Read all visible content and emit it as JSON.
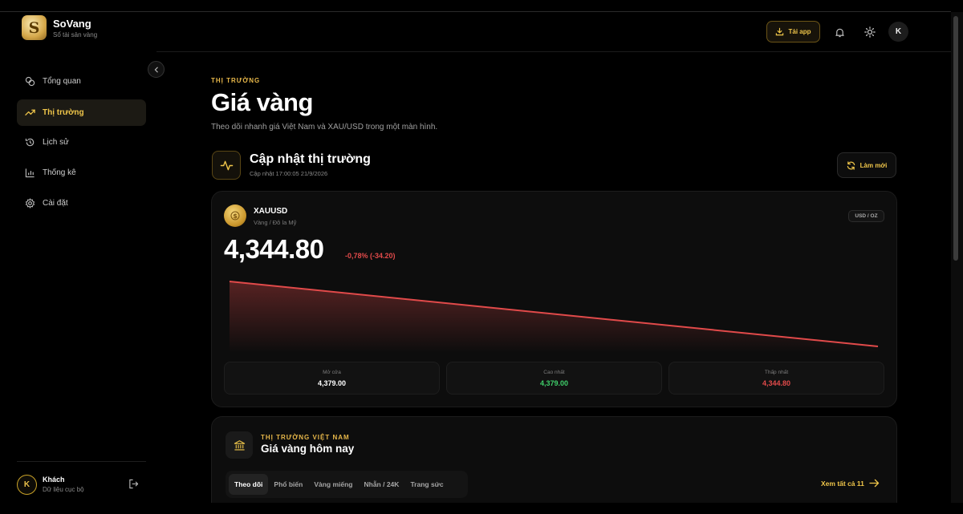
{
  "brand": {
    "name": "SoVang",
    "subtitle": "Sổ tài sản vàng",
    "logo_letter": "S"
  },
  "sidebar": {
    "items": [
      {
        "label": "Tổng quan",
        "icon": "coins-icon",
        "active": false
      },
      {
        "label": "Thị trường",
        "icon": "trending-up-icon",
        "active": true
      },
      {
        "label": "Lịch sử",
        "icon": "history-icon",
        "active": false
      },
      {
        "label": "Thống kê",
        "icon": "bar-chart-icon",
        "active": false
      },
      {
        "label": "Cài đặt",
        "icon": "gear-icon",
        "active": false
      }
    ],
    "user": {
      "initial": "K",
      "name": "Khách",
      "subtitle": "Dữ liệu cục bộ"
    }
  },
  "topbar": {
    "app_button": "Tải app",
    "avatar_initial": "K"
  },
  "header": {
    "eyebrow": "THỊ TRƯỜNG",
    "title": "Giá vàng",
    "subtitle": "Theo dõi nhanh giá Việt Nam và XAU/USD trong một màn hình."
  },
  "update": {
    "title": "Cập nhật thị trường",
    "time": "Cập nhật 17:00:05 21/9/2026",
    "refresh_label": "Làm mới"
  },
  "market": {
    "symbol": "XAUUSD",
    "symbol_sub": "Vàng / Đô la Mỹ",
    "unit": "USD / OZ",
    "price": "4,344.80",
    "change": "-0,78% (-34.20)",
    "trend_color": "#e14a4a",
    "stats": [
      {
        "label": "Mở cửa",
        "value": "4,379.00",
        "color": "#ffffff"
      },
      {
        "label": "Cao nhất",
        "value": "4,379.00",
        "color": "#3fcf6a"
      },
      {
        "label": "Thấp nhất",
        "value": "4,344.80",
        "color": "#e14a4a"
      }
    ]
  },
  "chart_data": {
    "type": "area",
    "x": [
      0,
      1
    ],
    "series": [
      {
        "values": [
          4379.0,
          4344.8
        ]
      }
    ],
    "ylim": [
      4344.8,
      4379.0
    ],
    "grid": false
  },
  "vietnam": {
    "eyebrow": "THỊ TRƯỜNG VIỆT NAM",
    "title": "Giá vàng hôm nay",
    "tabs": [
      "Theo dõi",
      "Phổ biến",
      "Vàng miếng",
      "Nhẫn / 24K",
      "Trang sức"
    ],
    "see_all": "Xem tất cả 11"
  },
  "colors": {
    "accent": "#f0c64a",
    "down": "#e14a4a",
    "up": "#3fcf6a",
    "background": "#000000"
  }
}
